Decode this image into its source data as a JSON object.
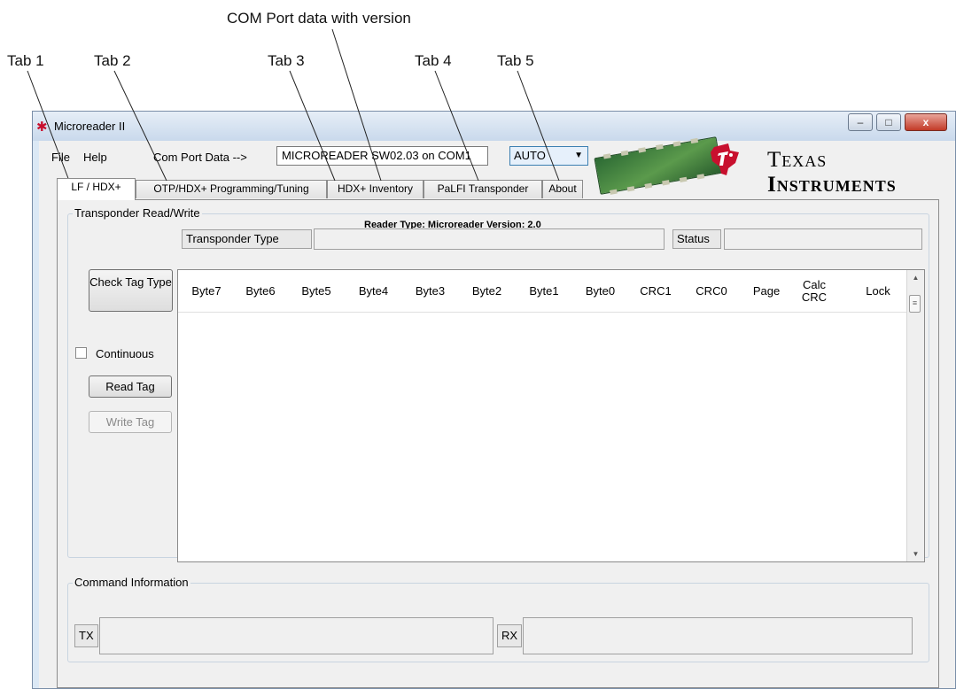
{
  "annotations": {
    "com_port_data": "COM Port data with version",
    "tab1": "Tab 1",
    "tab2": "Tab 2",
    "tab3": "Tab 3",
    "tab4": "Tab 4",
    "tab5": "Tab 5"
  },
  "window": {
    "title": "Microreader II",
    "minimize": "–",
    "maximize": "□",
    "close": "x",
    "icon": "ti-app-icon"
  },
  "menu": {
    "file": "File",
    "help": "Help",
    "com_port_label": "Com Port Data -->",
    "com_port_value": "MICROREADER SW02.03 on COM1",
    "mode_select": "AUTO"
  },
  "logo": {
    "line1": "Texas",
    "line2": "Instruments",
    "image": "reader-board-photo"
  },
  "tabs": [
    {
      "label": "LF / HDX+",
      "active": true
    },
    {
      "label": "OTP/HDX+ Programming/Tuning",
      "active": false
    },
    {
      "label": "HDX+ Inventory",
      "active": false
    },
    {
      "label": "PaLFI Transponder",
      "active": false
    },
    {
      "label": "About",
      "active": false
    }
  ],
  "transponder": {
    "group_title": "Transponder Read/Write",
    "reader_type": "Reader Type: Microreader   Version: 2.0",
    "type_label": "Transponder Type",
    "type_value": "",
    "status_label": "Status",
    "status_value": "",
    "check_tag_button": "Check Tag Type",
    "continuous_label": "Continuous",
    "continuous_checked": false,
    "read_tag_button": "Read Tag",
    "write_tag_button": "Write Tag"
  },
  "table": {
    "columns": [
      "Byte7",
      "Byte6",
      "Byte5",
      "Byte4",
      "Byte3",
      "Byte2",
      "Byte1",
      "Byte0",
      "CRC1",
      "CRC0",
      "Page",
      "Calc CRC",
      "Lock"
    ],
    "rows": []
  },
  "command": {
    "group_title": "Command Information",
    "tx_label": "TX",
    "tx_value": "",
    "rx_label": "RX",
    "rx_value": ""
  },
  "colors": {
    "ti_red": "#c8102e",
    "frame_blue": "#dbe8f5",
    "select_highlight": "#3c7fb1"
  }
}
